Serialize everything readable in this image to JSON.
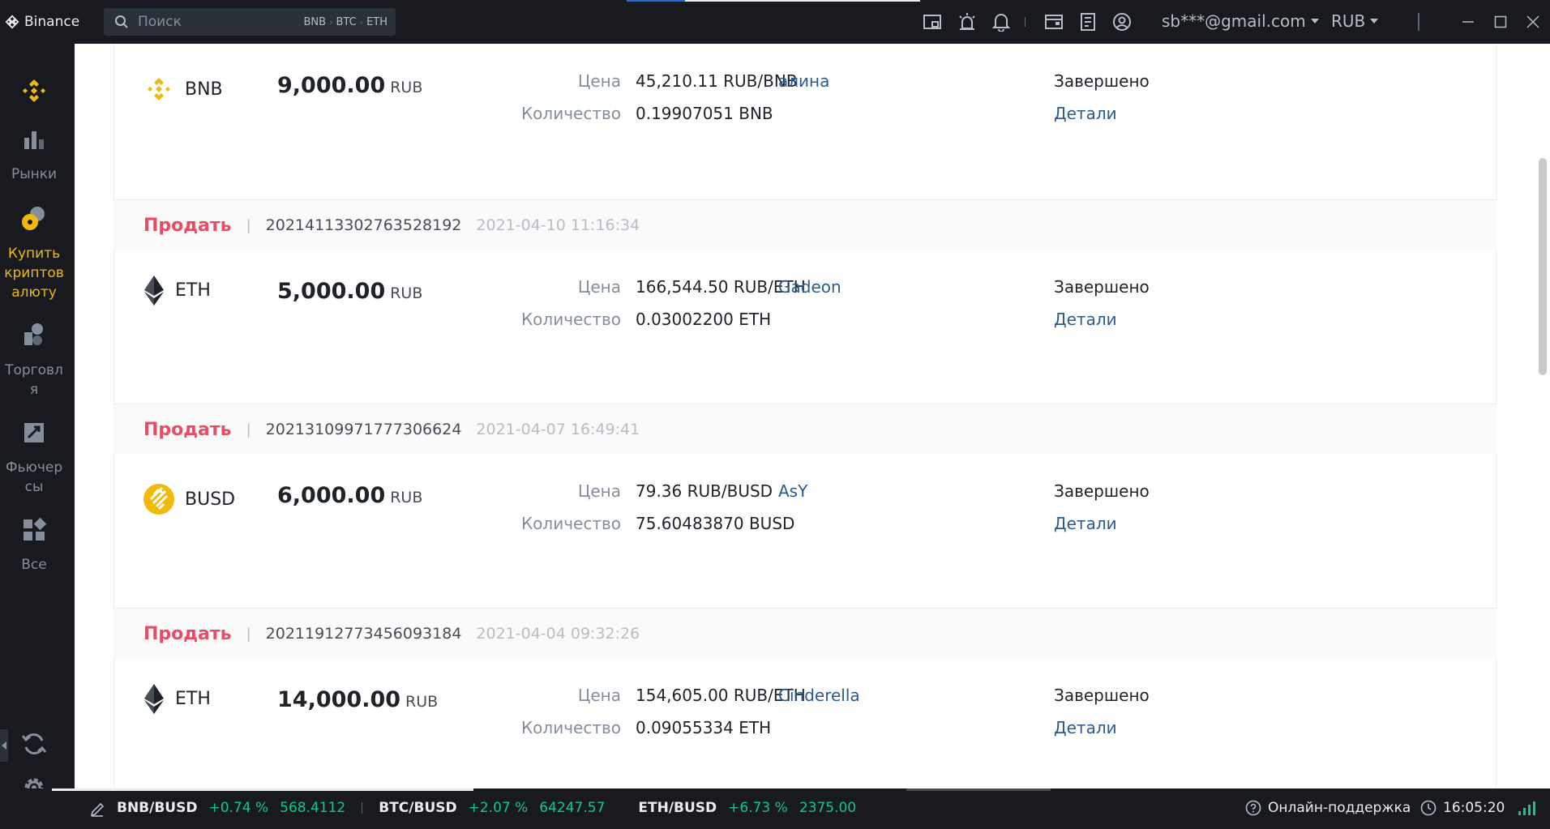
{
  "titlebar": {
    "app_name": "Binance",
    "search_placeholder": "Поиск",
    "search_tags": [
      "BNB",
      "BTC",
      "ETH"
    ],
    "account": "sb***@gmail.com",
    "currency": "RUB"
  },
  "sidebar": {
    "items": [
      {
        "label": "Рынки",
        "icon": "markets-icon"
      },
      {
        "label": "Купить криптовалюту",
        "label_lines": [
          "Купить",
          "криптов",
          "алюту"
        ],
        "icon": "buy-crypto-icon",
        "active": true
      },
      {
        "label": "Торговля",
        "label_lines": [
          "Торговл",
          "я"
        ],
        "icon": "trade-icon"
      },
      {
        "label": "Фьючерсы",
        "label_lines": [
          "Фьючер",
          "сы"
        ],
        "icon": "futures-icon"
      },
      {
        "label": "Все",
        "icon": "all-icon"
      }
    ]
  },
  "labels": {
    "price": "Цена",
    "quantity": "Количество",
    "details": "Детали"
  },
  "orders": [
    {
      "side": "",
      "order_id": "",
      "datetime": "",
      "coin": "BNB",
      "amount": "9,000.00",
      "fiat": "RUB",
      "price": "45,210.11 RUB/BNB",
      "quantity": "0.19907051 BNB",
      "counterparty": "алина",
      "status": "Завершено"
    },
    {
      "side": "Продать",
      "order_id": "20214113302763528192",
      "datetime": "2021-04-10 11:16:34",
      "coin": "ETH",
      "amount": "5,000.00",
      "fiat": "RUB",
      "price": "166,544.50 RUB/ETH",
      "quantity": "0.03002200 ETH",
      "counterparty": "Gadeon",
      "status": "Завершено"
    },
    {
      "side": "Продать",
      "order_id": "20213109971777306624",
      "datetime": "2021-04-07 16:49:41",
      "coin": "BUSD",
      "amount": "6,000.00",
      "fiat": "RUB",
      "price": "79.36 RUB/BUSD",
      "quantity": "75.60483870 BUSD",
      "counterparty": "AsY",
      "status": "Завершено"
    },
    {
      "side": "Продать",
      "order_id": "20211912773456093184",
      "datetime": "2021-04-04 09:32:26",
      "coin": "ETH",
      "amount": "14,000.00",
      "fiat": "RUB",
      "price": "154,605.00 RUB/ETH",
      "quantity": "0.09055334 ETH",
      "counterparty": "Cinderella",
      "status": "Завершено"
    }
  ],
  "statusbar": {
    "tickers": [
      {
        "pair": "BNB/BUSD",
        "change": "+0.74 %",
        "price": "568.4112"
      },
      {
        "pair": "BTC/BUSD",
        "change": "+2.07 %",
        "price": "64247.57"
      },
      {
        "pair": "ETH/BUSD",
        "change": "+6.73 %",
        "price": "2375.00"
      }
    ],
    "support": "Онлайн-поддержка",
    "time": "16:05:20"
  },
  "colors": {
    "sell": "#e84d65",
    "positive": "#0ecb81",
    "brand": "#f0b90b",
    "link": "#2d5a8e",
    "dark_bg": "#181a20"
  }
}
